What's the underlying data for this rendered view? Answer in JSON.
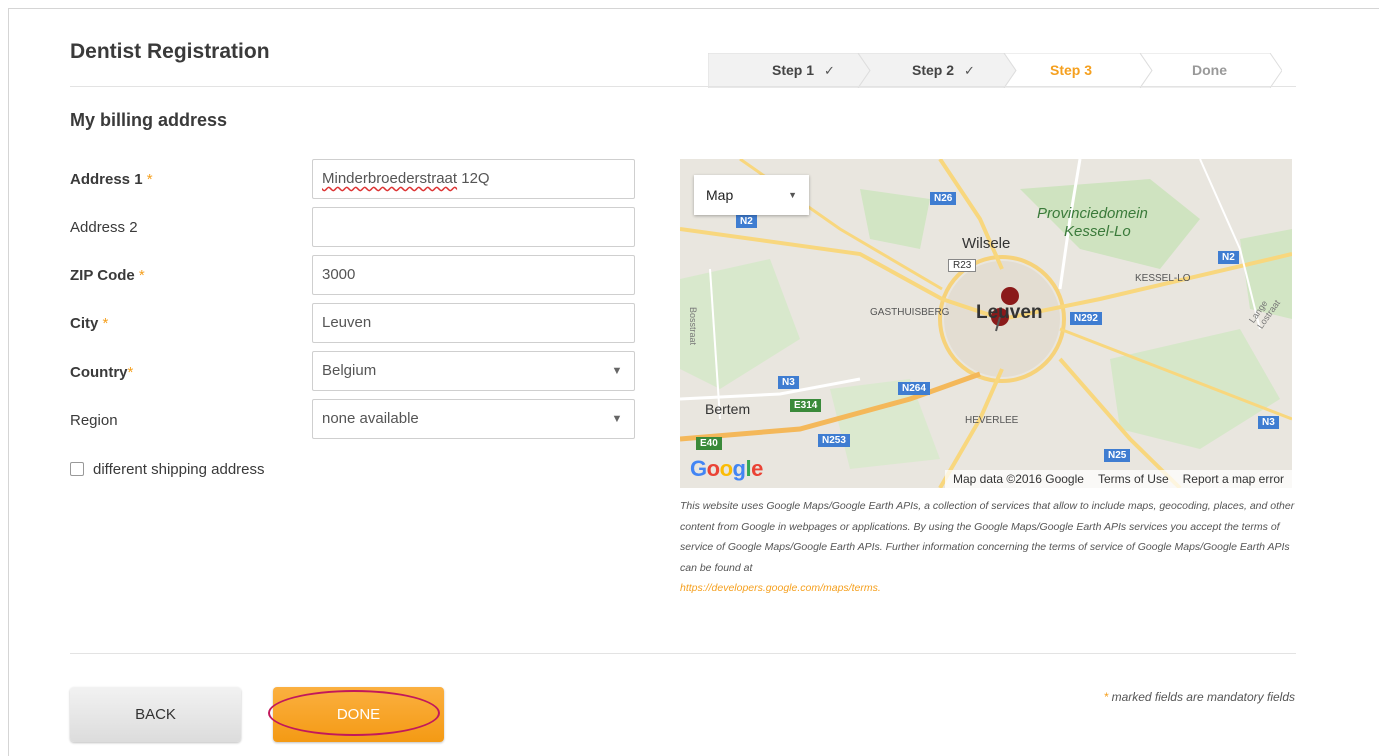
{
  "page": {
    "title": "Dentist Registration",
    "section_title": "My billing address"
  },
  "steps": [
    {
      "label": "Step 1",
      "check": "✓",
      "state": "done"
    },
    {
      "label": "Step 2",
      "check": "✓",
      "state": "done"
    },
    {
      "label": "Step 3",
      "check": "",
      "state": "active"
    },
    {
      "label": "Done",
      "check": "",
      "state": "pending"
    }
  ],
  "form": {
    "address1": {
      "label": "Address 1",
      "required_mark": "*",
      "value": "Minderbroederstraat",
      "value_suffix": " 12Q"
    },
    "address2": {
      "label": "Address 2",
      "value": ""
    },
    "zip": {
      "label": "ZIP Code",
      "required_mark": "*",
      "value": "3000"
    },
    "city": {
      "label": "City",
      "required_mark": "*",
      "value": "Leuven"
    },
    "country": {
      "label": "Country",
      "required_mark": "*",
      "value": "Belgium"
    },
    "region": {
      "label": "Region",
      "value": "none available"
    },
    "shipping_checkbox": {
      "label": "different shipping address",
      "checked": false
    }
  },
  "map": {
    "type_selector": "Map",
    "labels": {
      "provinciedomein": "Provinciedomein",
      "kessel_lo_park": "Kessel-Lo",
      "wilsele": "Wilsele",
      "kessel_lo": "KESSEL-LO",
      "gasthuisberg": "GASTHUISBERG",
      "leuven": "Leuven",
      "bertem": "Bertem",
      "heverlee": "HEVERLEE",
      "bosstraat": "Bosstraat",
      "lange_lostraat": "Lange Lostraat"
    },
    "road_shields": [
      "N26",
      "N2",
      "R23",
      "N2",
      "N292",
      "N3",
      "N264",
      "E314",
      "N253",
      "E40",
      "N25",
      "N3"
    ],
    "logo": "Google",
    "footer": {
      "data": "Map data ©2016 Google",
      "terms": "Terms of Use",
      "report": "Report a map error"
    }
  },
  "disclaimer": {
    "text": "This website uses Google Maps/Google Earth APIs, a collection of services that allow to include maps, geocoding, places, and other content from Google in webpages or applications. By using the Google Maps/Google Earth APIs services you accept the terms of service of Google Maps/Google Earth APIs. Further information concerning the terms of service of Google Maps/Google Earth APIs can be found at",
    "link": "https://developers.google.com/maps/terms."
  },
  "footer": {
    "mandatory_star": "*",
    "mandatory_note": " marked fields are mandatory fields",
    "back_label": "BACK",
    "done_label": "DONE"
  },
  "colors": {
    "accent": "#f5a01f",
    "highlight_ring": "#c2185b"
  }
}
